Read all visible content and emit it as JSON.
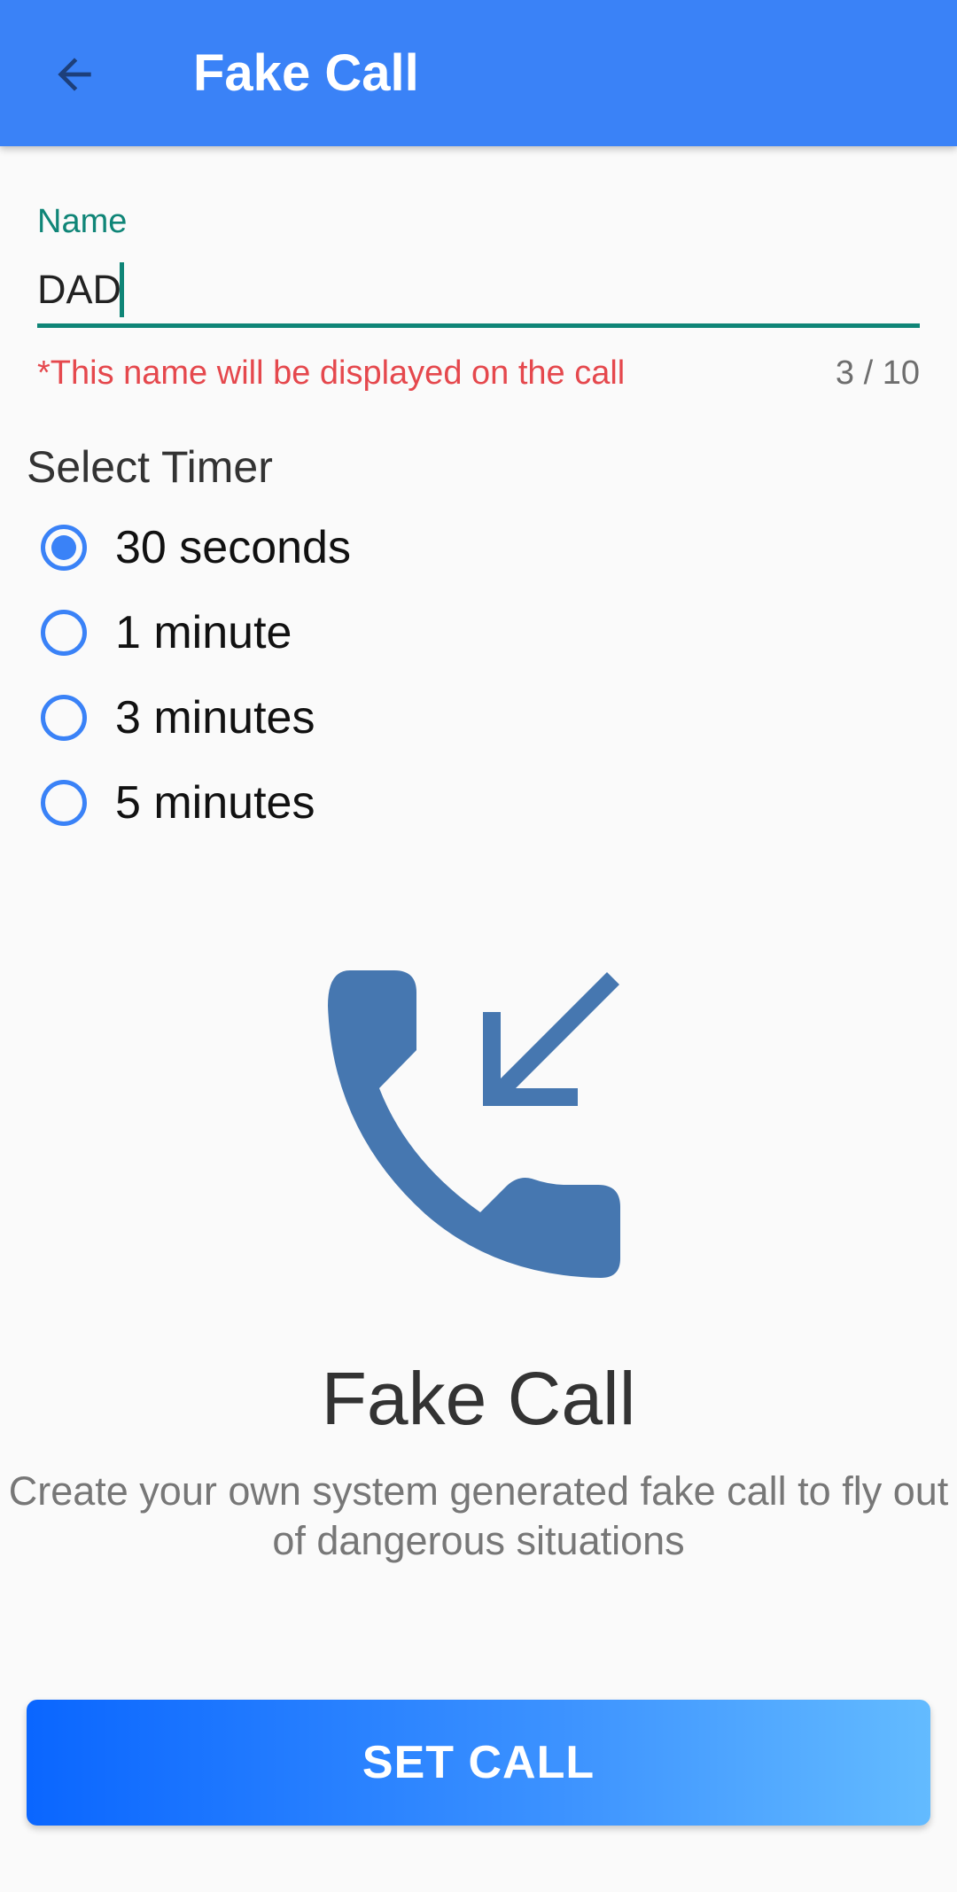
{
  "app_bar": {
    "title": "Fake Call",
    "back_icon": "arrow-back-icon",
    "color": "#3a82f7"
  },
  "name_field": {
    "label": "Name",
    "value": "DAD",
    "helper_text": "*This name will be displayed on the call",
    "counter": "3 / 10",
    "accent_color": "#0f8577",
    "helper_color": "#e5484d"
  },
  "timer": {
    "title": "Select Timer",
    "options": [
      {
        "label": "30 seconds",
        "selected": true
      },
      {
        "label": "1 minute",
        "selected": false
      },
      {
        "label": "3 minutes",
        "selected": false
      },
      {
        "label": "5 minutes",
        "selected": false
      }
    ]
  },
  "hero": {
    "icon": "incoming-call-icon",
    "icon_color": "#4677b0",
    "title": "Fake Call",
    "description": "Create your own system generated fake call to fly out of dangerous situations"
  },
  "action": {
    "label": "SET CALL"
  }
}
